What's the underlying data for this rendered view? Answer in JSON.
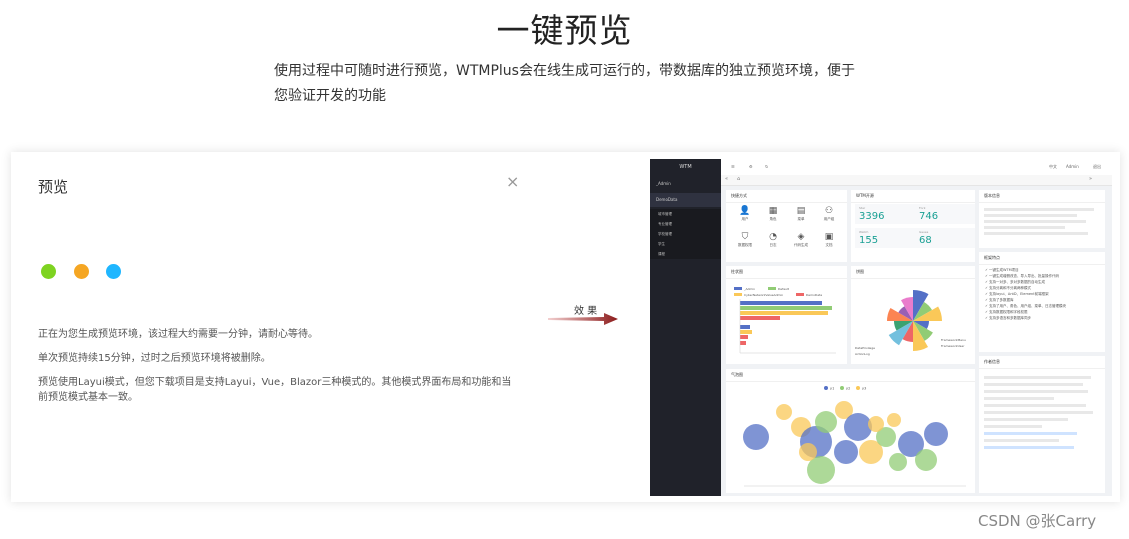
{
  "page": {
    "title": "一键预览",
    "subtitle": "使用过程中可随时进行预览，WTMPlus会在线生成可运行的，带数据库的独立预览环境，便于您验证开发的功能"
  },
  "dialog": {
    "title": "预览",
    "close_glyph": "×",
    "dot_colors": [
      "#7ed321",
      "#f5a623",
      "#1fb6ff"
    ],
    "messages": [
      "正在为您生成预览环境，该过程大约需要一分钟，请耐心等待。",
      "单次预览持续15分钟，过时之后预览环境将被删除。",
      "预览使用Layui模式，但您下载项目是支持Layui，Vue，Blazor三种模式的。其他模式界面布局和功能和当前预览模式基本一致。"
    ]
  },
  "arrow": {
    "label": "效 果",
    "color": "#8b1a1a"
  },
  "preview": {
    "brand": "WTM",
    "sidebar": [
      {
        "label": "_Admin",
        "icon": "folder-icon"
      },
      {
        "label": "DemoData",
        "icon": "folder-icon"
      }
    ],
    "sidebar_sub": [
      "城市管理",
      "专业管理",
      "学校管理",
      "学生",
      "课程"
    ],
    "topbar": {
      "user": "Admin",
      "lang": "中文",
      "logout": "退出"
    },
    "quick_title": "快捷方式",
    "quick_items": [
      "用户",
      "角色",
      "菜单",
      "用户组",
      "数据权限",
      "日志",
      "代码生成",
      "文档"
    ],
    "stats_title": "WTM开源",
    "stats": [
      {
        "label": "Star",
        "value": "3396"
      },
      {
        "label": "Fork",
        "value": "746"
      },
      {
        "label": "Watch",
        "value": "155"
      },
      {
        "label": "Issues",
        "value": "68"
      }
    ],
    "bar_title": "柱状图",
    "bar_legend": [
      "_Admin",
      "Default",
      "CyberNetworkValueAdmin",
      "DemoData"
    ],
    "pie_title": "饼图",
    "pie_labels": [
      "FrameworkMenu",
      "FrameworkUser",
      "DataPrivilege",
      "ActionLog"
    ],
    "bubble_title": "气泡图",
    "bubble_legend": [
      "y1",
      "y2",
      "y3"
    ],
    "news_title": "版本信息",
    "feature_title": "框架特点",
    "feature_lines": [
      "一键生成WTM项目",
      "一键生成增删改查、导入导出、批量操作代码",
      "支持一对多、多对多数据的自动生成",
      "支持分离和不分离两种模式",
      "支持layui、AntD、Element前端框架",
      "支持了多数据库",
      "支持了用户、角色、用户组、菜单、日志管理模块",
      "支持数据权限和字段权限",
      "支持多语言和多数据库同步"
    ],
    "author_title": "作者信息"
  },
  "watermark": "CSDN @张Carry"
}
